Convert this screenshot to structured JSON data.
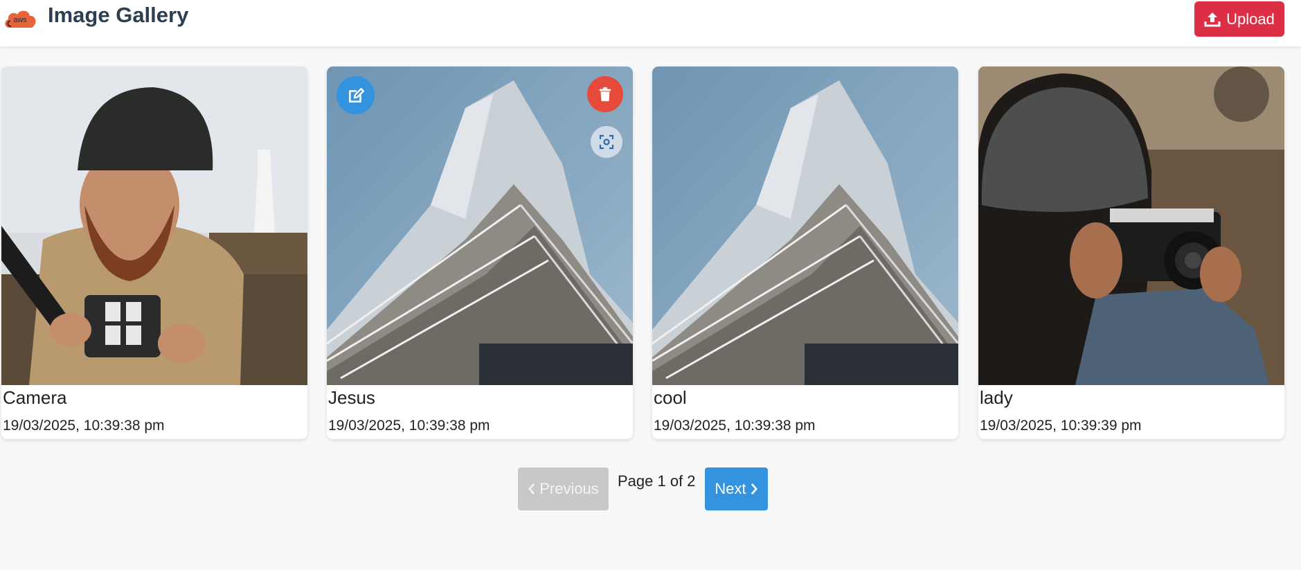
{
  "header": {
    "logo_text": "aws",
    "title": "Image Gallery",
    "upload_label": "Upload"
  },
  "cards": [
    {
      "name": "Camera",
      "date": "19/03/2025, 10:39:38 pm",
      "image": "man-with-memory-cards-photo"
    },
    {
      "name": "Jesus",
      "date": "19/03/2025, 10:39:38 pm",
      "image": "skyscraper-photo"
    },
    {
      "name": "cool",
      "date": "19/03/2025, 10:39:38 pm",
      "image": "skyscraper-photo"
    },
    {
      "name": "lady",
      "date": "19/03/2025, 10:39:39 pm",
      "image": "person-with-camera-photo"
    }
  ],
  "card_actions": {
    "edit_icon": "edit-icon",
    "delete_icon": "trash-icon",
    "scan_icon": "scan-icon"
  },
  "pagination": {
    "previous_label": "Previous",
    "page_info": "Page 1 of 2",
    "next_label": "Next"
  },
  "colors": {
    "upload_button": "#dc2f45",
    "primary_blue": "#3393df",
    "delete_red": "#e74a3b",
    "disabled_gray": "#c8c8c8",
    "title": "#2c3e50"
  }
}
